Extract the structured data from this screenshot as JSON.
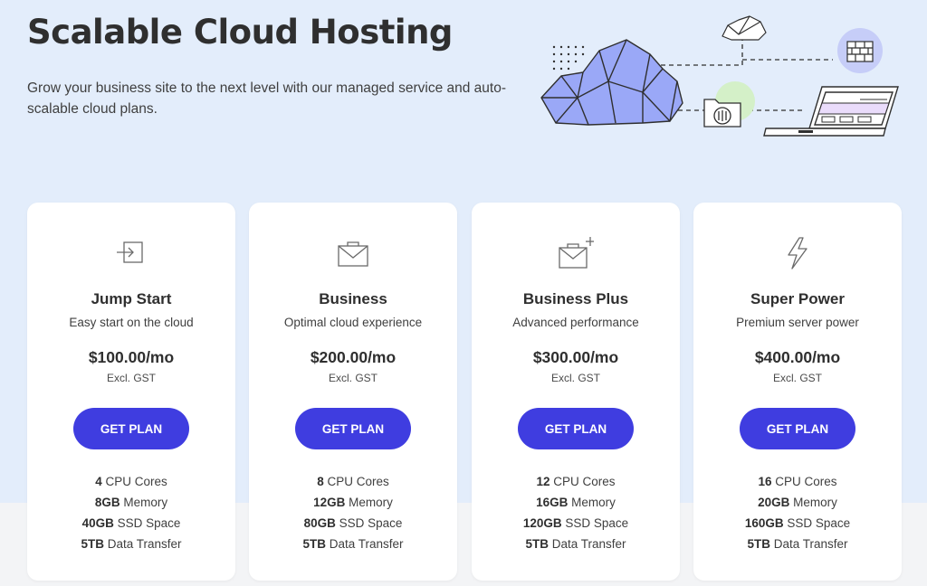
{
  "hero": {
    "title": "Scalable Cloud Hosting",
    "subtitle": "Grow your business site to the next level with our managed service and auto-scalable cloud plans."
  },
  "illustration": {
    "icons": [
      "cloud-icon",
      "small-cloud-icon",
      "firewall-icon",
      "folder-settings-icon",
      "laptop-icon"
    ],
    "accent_color": "#9aa8f7"
  },
  "colors": {
    "page_background": "#e3edfb",
    "card_background": "#ffffff",
    "button": "#3f3de0",
    "button_text": "#ffffff"
  },
  "plans": [
    {
      "icon": "enter-arrow-icon",
      "name": "Jump Start",
      "tagline": "Easy start on the cloud",
      "price": "$100.00/mo",
      "tax_note": "Excl. GST",
      "button": "GET PLAN",
      "specs": [
        {
          "value": "4",
          "label": "CPU Cores"
        },
        {
          "value": "8GB",
          "label": "Memory"
        },
        {
          "value": "40GB",
          "label": "SSD Space"
        },
        {
          "value": "5TB",
          "label": "Data Transfer"
        }
      ]
    },
    {
      "icon": "briefcase-envelope-icon",
      "name": "Business",
      "tagline": "Optimal cloud experience",
      "price": "$200.00/mo",
      "tax_note": "Excl. GST",
      "button": "GET PLAN",
      "specs": [
        {
          "value": "8",
          "label": "CPU Cores"
        },
        {
          "value": "12GB",
          "label": "Memory"
        },
        {
          "value": "80GB",
          "label": "SSD Space"
        },
        {
          "value": "5TB",
          "label": "Data Transfer"
        }
      ]
    },
    {
      "icon": "briefcase-plus-icon",
      "name": "Business Plus",
      "tagline": "Advanced performance",
      "price": "$300.00/mo",
      "tax_note": "Excl. GST",
      "button": "GET PLAN",
      "specs": [
        {
          "value": "12",
          "label": "CPU Cores"
        },
        {
          "value": "16GB",
          "label": "Memory"
        },
        {
          "value": "120GB",
          "label": "SSD Space"
        },
        {
          "value": "5TB",
          "label": "Data Transfer"
        }
      ]
    },
    {
      "icon": "lightning-icon",
      "name": "Super Power",
      "tagline": "Premium server power",
      "price": "$400.00/mo",
      "tax_note": "Excl. GST",
      "button": "GET PLAN",
      "specs": [
        {
          "value": "16",
          "label": "CPU Cores"
        },
        {
          "value": "20GB",
          "label": "Memory"
        },
        {
          "value": "160GB",
          "label": "SSD Space"
        },
        {
          "value": "5TB",
          "label": "Data Transfer"
        }
      ]
    }
  ]
}
